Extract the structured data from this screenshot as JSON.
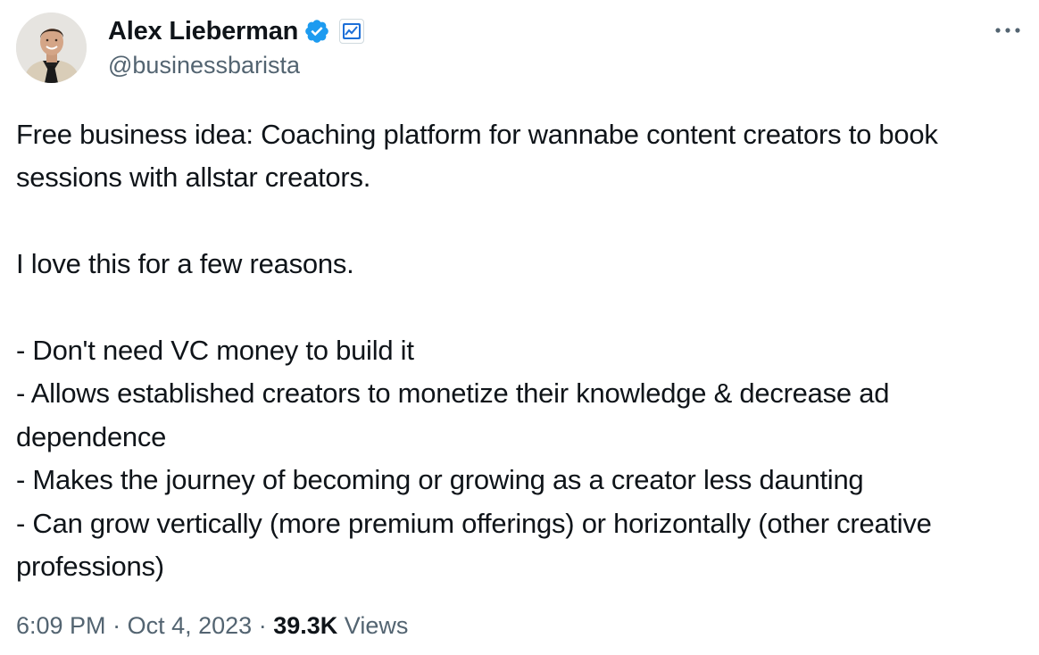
{
  "author": {
    "display_name": "Alex Lieberman",
    "handle": "@businessbarista",
    "verified_badge_color": "#1d9bf0",
    "avatar": "avatar-photo",
    "affiliation_badge": "chart-badge-icon"
  },
  "tweet": {
    "text": "Free business idea: Coaching platform for wannabe content creators to book sessions with allstar creators.\n\nI love this for a few reasons.\n\n- Don't need VC money to build it\n- Allows established creators to monetize their knowledge & decrease ad dependence\n- Makes the journey of becoming or growing as a creator less daunting\n- Can grow vertically (more premium offerings) or horizontally (other creative professions)",
    "time": "6:09 PM",
    "separator": "·",
    "date": "Oct 4, 2023",
    "views_count": "39.3K",
    "views_label": "Views"
  },
  "actions": {
    "more_icon": "more-horizontal-icon"
  },
  "colors": {
    "text": "#0f1419",
    "secondary": "#536471",
    "accent": "#1d9bf0"
  }
}
